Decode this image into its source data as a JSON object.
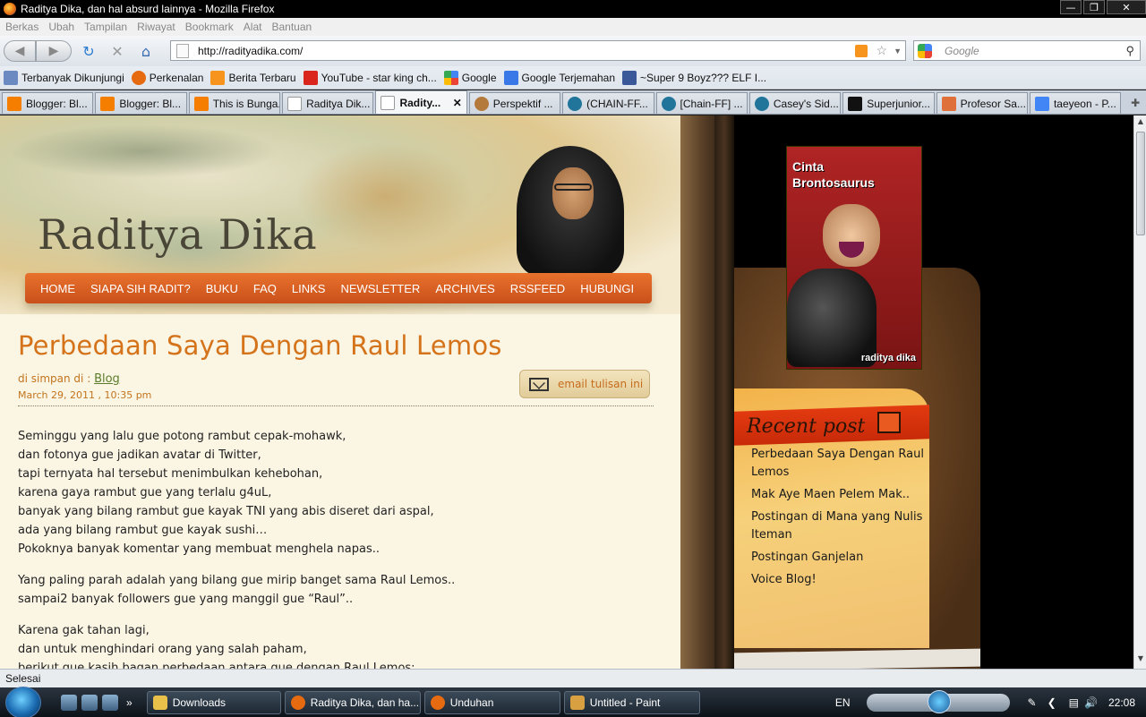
{
  "window": {
    "title": "Raditya Dika, dan hal absurd lainnya - Mozilla Firefox"
  },
  "menu": [
    "Berkas",
    "Ubah",
    "Tampilan",
    "Riwayat",
    "Bookmark",
    "Alat",
    "Bantuan"
  ],
  "address": {
    "url": "http://radityadika.com/"
  },
  "search": {
    "placeholder": "Google"
  },
  "bookmarks": [
    {
      "label": "Terbanyak Dikunjungi",
      "icon": "bookmark-icon",
      "color": "#6b8ac2"
    },
    {
      "label": "Perkenalan",
      "icon": "firefox-icon",
      "color": "#e66a10"
    },
    {
      "label": "Berita Terbaru",
      "icon": "rss-icon",
      "color": "#f7941d"
    },
    {
      "label": "YouTube - star king ch...",
      "icon": "youtube-icon",
      "color": "#d9251c"
    },
    {
      "label": "Google",
      "icon": "google-icon",
      "color": "#4285f4"
    },
    {
      "label": "Google Terjemahan",
      "icon": "translate-icon",
      "color": "#3b78e7"
    },
    {
      "label": "~Super 9 Boyz??? ELF I...",
      "icon": "facebook-icon",
      "color": "#3b5998"
    }
  ],
  "tabs": [
    {
      "label": "Blogger: Bl...",
      "color": "#f57d00",
      "active": false
    },
    {
      "label": "Blogger: Bl...",
      "color": "#f57d00",
      "active": false
    },
    {
      "label": "This is Bunga...",
      "color": "#f57d00",
      "active": false
    },
    {
      "label": "Raditya Dik...",
      "color": "#ffffff",
      "active": false
    },
    {
      "label": "Radity...",
      "color": "#ffffff",
      "active": true
    },
    {
      "label": "Perspektif ...",
      "color": "#b47a3c",
      "active": false
    },
    {
      "label": "(CHAIN-FF...",
      "color": "#21759b",
      "active": false
    },
    {
      "label": "[Chain-FF] ...",
      "color": "#21759b",
      "active": false
    },
    {
      "label": "Casey's Sid...",
      "color": "#21759b",
      "active": false
    },
    {
      "label": "Superjunior...",
      "color": "#111111",
      "active": false
    },
    {
      "label": "Profesor Sa...",
      "color": "#e0703a",
      "active": false
    },
    {
      "label": "taeyeon - P...",
      "color": "#4285f4",
      "active": false
    }
  ],
  "blog": {
    "title": "Raditya Dika",
    "nav": [
      "HOME",
      "SIAPA SIH RADIT?",
      "BUKU",
      "FAQ",
      "LINKS",
      "NEWSLETTER",
      "ARCHIVES",
      "RSSFEED",
      "HUBUNGI"
    ],
    "post": {
      "title": "Perbedaan Saya Dengan Raul Lemos",
      "saved_in_label": "di simpan di :",
      "category": "Blog",
      "date": "March 29, 2011 , 10:35 pm",
      "email_label": "email tulisan ini",
      "paragraphs": [
        [
          "Seminggu yang lalu gue potong rambut cepak-mohawk,",
          "dan fotonya gue jadikan avatar di Twitter,",
          "tapi ternyata hal tersebut menimbulkan kehebohan,",
          "karena gaya rambut gue yang terlalu g4uL,",
          "banyak yang bilang rambut gue kayak TNI yang abis diseret dari aspal,",
          "ada yang bilang rambut gue kayak sushi…",
          "Pokoknya banyak komentar yang membuat menghela napas.."
        ],
        [
          "Yang paling parah adalah yang bilang gue mirip banget sama Raul Lemos..",
          "sampai2 banyak followers gue yang manggil gue “Raul”.."
        ],
        [
          "Karena gak tahan lagi,",
          "dan untuk menghindari orang yang salah paham,",
          "berikut gue kasih bagan perbedaan antara gue dengan Raul Lemos:"
        ]
      ]
    },
    "sidebar": {
      "book": {
        "title_line1": "Cinta",
        "title_line2": "Brontosaurus",
        "author": "raditya dika"
      },
      "recent_heading": "Recent post",
      "recent_posts": [
        "Perbedaan Saya Dengan Raul Lemos",
        "Mak Aye Maen Pelem Mak..",
        "Postingan di Mana yang Nulis Iteman",
        "Postingan Ganjelan",
        "Voice Blog!"
      ]
    }
  },
  "status": {
    "text": "Selesai"
  },
  "taskbar": {
    "buttons": [
      {
        "label": "Downloads",
        "color": "#e8c14a"
      },
      {
        "label": "Raditya Dika, dan ha...",
        "color": "#e66a10"
      },
      {
        "label": "Unduhan",
        "color": "#e66a10"
      },
      {
        "label": "Untitled - Paint",
        "color": "#d8a040"
      }
    ],
    "language": "EN",
    "time": "22:08"
  }
}
